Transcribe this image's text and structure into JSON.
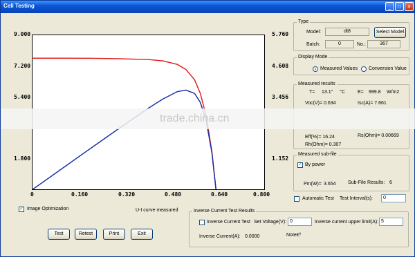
{
  "window": {
    "title": "Cell Testing"
  },
  "chart_data": {
    "type": "line",
    "x_ticks": [
      "0",
      "0.160",
      "0.320",
      "0.480",
      "0.640",
      "0.800"
    ],
    "y_left_ticks": [
      "9.000",
      "7.200",
      "5.400",
      "1.800"
    ],
    "y_right_ticks": [
      "5.760",
      "4.608",
      "3.456",
      "1.152"
    ],
    "xlim": [
      0,
      0.8
    ],
    "ylim_left": [
      0,
      9
    ],
    "ylim_right": [
      0,
      5.76
    ],
    "series": [
      {
        "color": "#e02020",
        "axis": "left",
        "x": [
          0,
          0.1,
          0.2,
          0.3,
          0.4,
          0.45,
          0.5,
          0.53,
          0.56,
          0.58,
          0.6,
          0.62,
          0.634
        ],
        "y": [
          7.661,
          7.66,
          7.65,
          7.63,
          7.58,
          7.5,
          7.3,
          7.0,
          6.4,
          5.6,
          4.3,
          2.2,
          0
        ]
      },
      {
        "color": "#1a2fa8",
        "axis": "right",
        "x": [
          0,
          0.1,
          0.2,
          0.3,
          0.4,
          0.45,
          0.5,
          0.53,
          0.56,
          0.58,
          0.6,
          0.62,
          0.634
        ],
        "y": [
          0,
          0.766,
          1.53,
          2.289,
          3.032,
          3.375,
          3.65,
          3.71,
          3.584,
          3.248,
          2.58,
          1.364,
          0
        ]
      }
    ]
  },
  "type_group": {
    "title": "Type",
    "model_label": "Model:",
    "model_value": "dt8",
    "select_model": "Select Model",
    "batch_label": "Batch:",
    "batch_value": "0",
    "no_label": "No.:",
    "no_value": "367"
  },
  "display_mode": {
    "title": "Display Mode",
    "measured": "Measured Values",
    "conversion": "Conversion Value"
  },
  "results": {
    "title": "Measured results",
    "t_label": "T=",
    "t_value": "13.1°",
    "t_unit": "°C",
    "e_label": "E=",
    "e_value": "999.8",
    "e_unit": "W/m2",
    "voc": "Voc(V)=  0.634",
    "isc": "Isc(A)=  7.661",
    "eff": "Eff(%)=  16.24",
    "rh": "Rh(Ohm)=  0.307",
    "rs": "Rs(Ohm)=  0.00669"
  },
  "subfile": {
    "title": "Measured sub-file",
    "by_power": "By power",
    "pm": "Pm(W)=",
    "pm_value": "3.654",
    "results_label": "Sub-File Results:",
    "results_value": "6"
  },
  "auto": {
    "label": "Automatic Test",
    "interval_label": "Test Interval(s):",
    "interval_value": "0"
  },
  "left_controls": {
    "image_opt": "Image Optimization",
    "curve_label": "U-I curve measured",
    "test": "Test",
    "retest": "Retest",
    "print": "Print",
    "exit": "Exit"
  },
  "inverse": {
    "title": "Inverse Current Test Results",
    "test_label": "Inverse Current Test",
    "set_voltage": "Set Voltage(V):",
    "set_voltage_value": "0",
    "upper_limit": "Inverse current upper limit(A):",
    "upper_limit_value": "5",
    "current": "Inverse Current(A):",
    "current_value": "0.0000",
    "note": "Note£º"
  },
  "watermark": "trade.china.cn"
}
